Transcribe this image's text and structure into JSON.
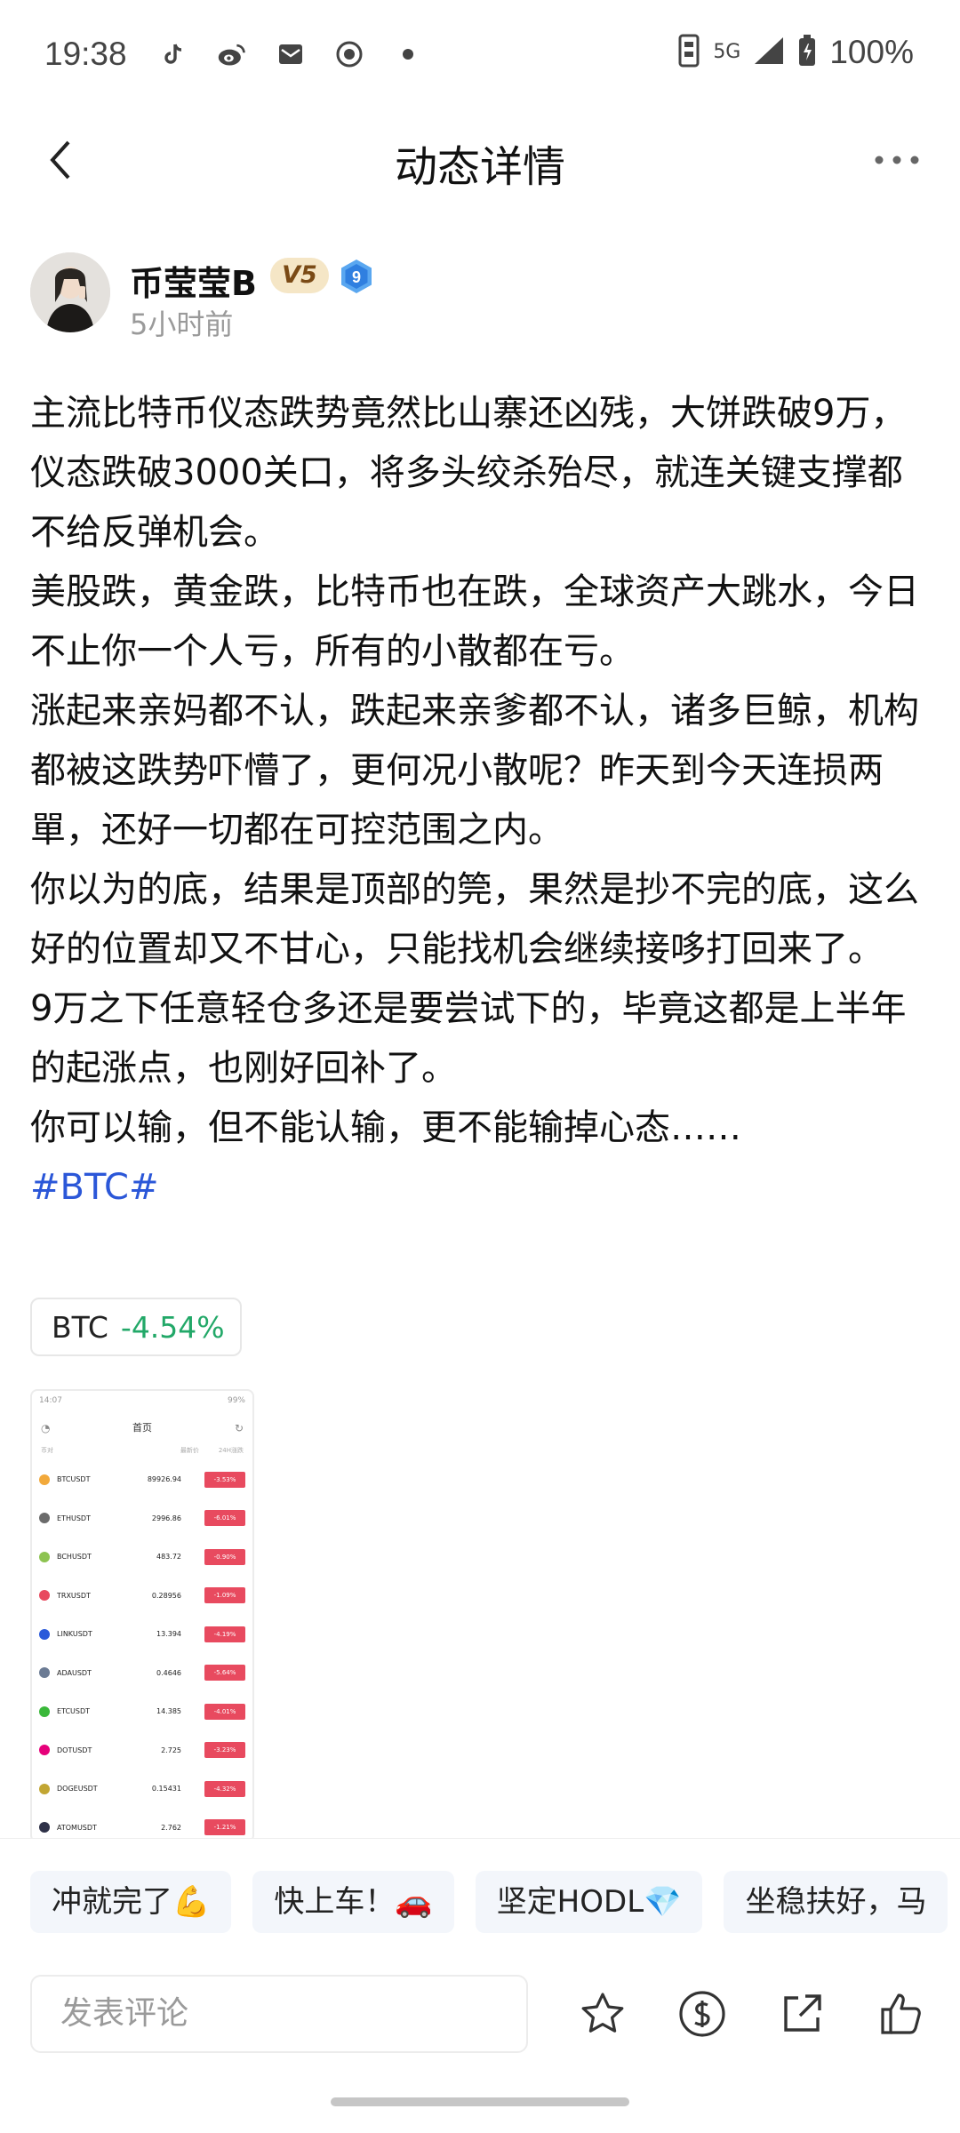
{
  "status_bar": {
    "time": "19:38",
    "network": "5G",
    "battery": "100%",
    "icons": [
      "tiktok-icon",
      "weibo-icon",
      "mail-icon",
      "circle-camera-icon",
      "dot-icon"
    ]
  },
  "header": {
    "title": "动态详情"
  },
  "author": {
    "name": "币莹莹B",
    "vip_badge": "V5",
    "level_badge": "9",
    "time_ago": "5小时前"
  },
  "post": {
    "paragraphs": [
      "主流比特币仪态跌势竟然比山寨还凶残，大饼跌破9万，仪态跌破3000关口，将多头绞杀殆尽，就连关键支撑都不给反弹机会。",
      "美股跌，黄金跌，比特币也在跌，全球资产大跳水，今日不止你一个人亏，所有的小散都在亏。",
      "涨起来亲妈都不认，跌起来亲爹都不认，诸多巨鲸，机构都被这跌势吓懵了，更何况小散呢？昨天到今天连损两單，还好一切都在可控范围之内。",
      "你以为的底，结果是顶部的筦，果然是抄不完的底，这么好的位置却又不甘心，只能找机会继续接哆打回来了。",
      "9万之下任意轻仓多还是要尝试下的，毕竟这都是上半年的起涨点，也刚好回补了。",
      "你可以输，但不能认输，更不能输掉心态……"
    ],
    "hashtag": "#BTC#"
  },
  "coin_chip": {
    "symbol": "BTC",
    "change": "-4.54%",
    "change_color": "#22a868"
  },
  "thumbnail": {
    "status_time": "14:07",
    "status_battery": "99%",
    "title": "首页",
    "col_left": "币对",
    "col_mid": "最新价",
    "col_right": "24H涨跌",
    "rows": [
      {
        "pair": "BTCUSDT",
        "price": "89926.94",
        "change": "-3.53%",
        "color": "#f2a93b"
      },
      {
        "pair": "ETHUSDT",
        "price": "2996.86",
        "change": "-6.01%",
        "color": "#6b6b6b"
      },
      {
        "pair": "BCHUSDT",
        "price": "483.72",
        "change": "-0.90%",
        "color": "#8dc351"
      },
      {
        "pair": "TRXUSDT",
        "price": "0.28956",
        "change": "-1.09%",
        "color": "#e84a5f"
      },
      {
        "pair": "LINKUSDT",
        "price": "13.394",
        "change": "-4.19%",
        "color": "#2a5ada"
      },
      {
        "pair": "ADAUSDT",
        "price": "0.4646",
        "change": "-5.64%",
        "color": "#6b7b94"
      },
      {
        "pair": "ETCUSDT",
        "price": "14.385",
        "change": "-4.01%",
        "color": "#3ab83a"
      },
      {
        "pair": "DOTUSDT",
        "price": "2.725",
        "change": "-3.23%",
        "color": "#e6007a"
      },
      {
        "pair": "DOGEUSDT",
        "price": "0.15431",
        "change": "-4.32%",
        "color": "#c2a633"
      },
      {
        "pair": "ATOMUSDT",
        "price": "2.762",
        "change": "-1.21%",
        "color": "#2e3148"
      }
    ]
  },
  "quick_replies": [
    "冲就完了💪",
    "快上车！🚗",
    "坚定HODL💎",
    "坐稳扶好，马"
  ],
  "bottom_bar": {
    "comment_placeholder": "发表评论",
    "actions": [
      "star-icon",
      "coin-icon",
      "share-icon",
      "like-icon"
    ]
  }
}
